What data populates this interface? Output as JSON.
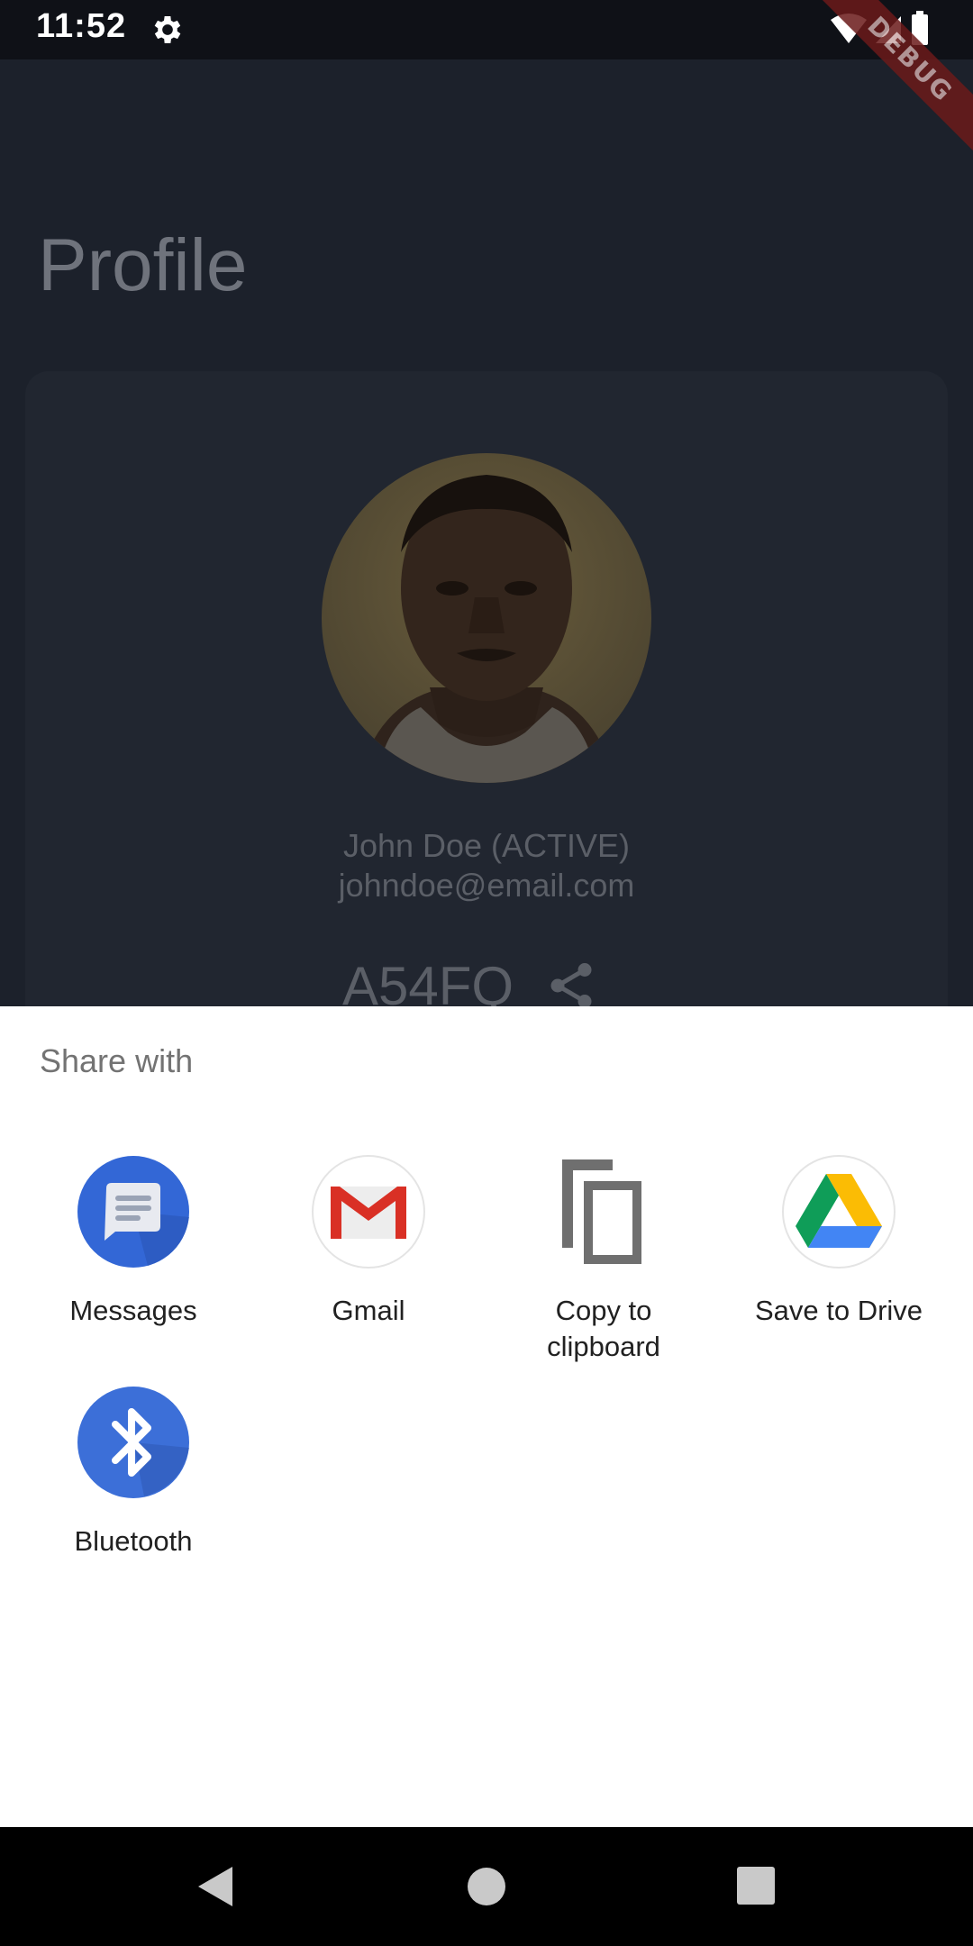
{
  "status_bar": {
    "time": "11:52",
    "debug_banner": "DEBUG",
    "icons": [
      "gear-icon",
      "wifi-icon",
      "cell-signal-icon",
      "battery-icon"
    ]
  },
  "profile": {
    "title": "Profile",
    "name": "John Doe (ACTIVE)",
    "email": "johndoe@email.com",
    "code": "A54FQ"
  },
  "share_sheet": {
    "title": "Share with",
    "targets": [
      {
        "label": "Messages",
        "icon": "messages-icon"
      },
      {
        "label": "Gmail",
        "icon": "gmail-icon"
      },
      {
        "label": "Copy to\nclipboard",
        "icon": "copy-icon"
      },
      {
        "label": "Save to Drive",
        "icon": "drive-icon"
      },
      {
        "label": "Bluetooth",
        "icon": "bluetooth-icon"
      }
    ]
  },
  "nav_bar": {
    "buttons": [
      "back-icon",
      "home-icon",
      "recents-icon"
    ]
  },
  "colors": {
    "background": "#1c212b",
    "card": "#212630",
    "sheet": "#ffffff",
    "messages_blue": "#3367d6",
    "bluetooth_blue": "#3c6fd8"
  }
}
